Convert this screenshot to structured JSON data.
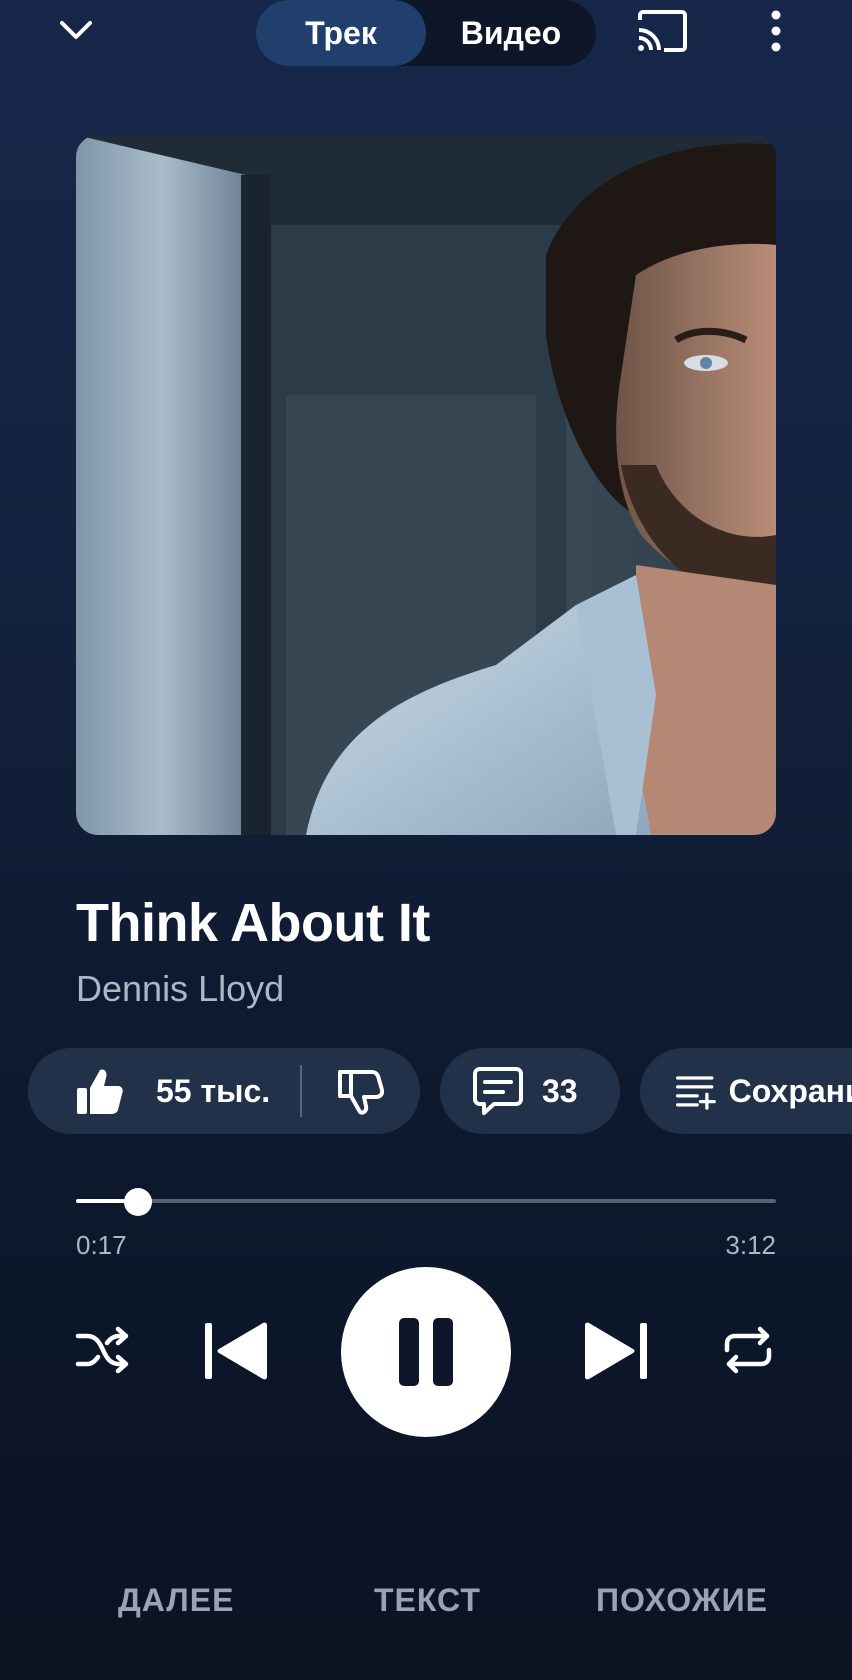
{
  "header": {
    "tabs": [
      {
        "label": "Трек",
        "active": true
      },
      {
        "label": "Видео",
        "active": false
      }
    ],
    "icons": [
      "chevron-down-icon",
      "cast-icon",
      "more-vertical-icon"
    ]
  },
  "track": {
    "title": "Think About It",
    "artist": "Dennis Lloyd"
  },
  "actions": {
    "likes": "55 тыс.",
    "comments": "33",
    "save_label": "Сохранить"
  },
  "progress": {
    "current_time": "0:17",
    "total_time": "3:12",
    "fraction": 0.089
  },
  "player": {
    "state": "playing",
    "icons": [
      "shuffle-icon",
      "previous-icon",
      "pause-icon",
      "next-icon",
      "repeat-icon"
    ]
  },
  "bottom_tabs": [
    {
      "label": "ДАЛЕЕ"
    },
    {
      "label": "ТЕКСТ"
    },
    {
      "label": "ПОХОЖИЕ"
    }
  ],
  "colors": {
    "background_top": "#16274a",
    "background_bottom": "#0a1322",
    "chip_background": "#22314a",
    "active_tab": "#213f6c",
    "secondary_text": "#aeb7c5"
  }
}
